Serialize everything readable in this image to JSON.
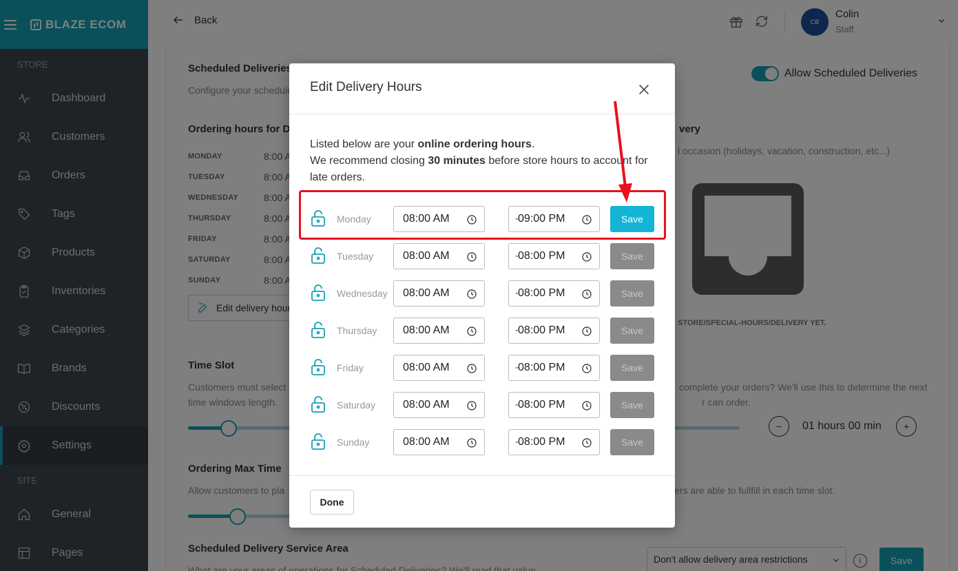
{
  "sidebar": {
    "brand": "BLAZE ECOM",
    "sections": [
      {
        "label": "STORE",
        "items": [
          "Dashboard",
          "Customers",
          "Orders",
          "Tags",
          "Products",
          "Inventories",
          "Categories",
          "Brands",
          "Discounts",
          "Settings"
        ]
      },
      {
        "label": "SITE",
        "items": [
          "General",
          "Pages"
        ]
      }
    ],
    "active_item": "Settings"
  },
  "topbar": {
    "back_label": "Back",
    "avatar_initials": "CB",
    "user_name": "Colin",
    "user_role": "Staff"
  },
  "background": {
    "scheduled_title": "Scheduled Deliveries",
    "scheduled_desc": "Configure your schedule",
    "toggle_label": "Allow Scheduled Deliveries",
    "ordering_hours_title": "Ordering hours for D",
    "days": [
      {
        "day": "MONDAY",
        "time": "8:00 A"
      },
      {
        "day": "TUESDAY",
        "time": "8:00 A"
      },
      {
        "day": "WEDNESDAY",
        "time": "8:00 A"
      },
      {
        "day": "THURSDAY",
        "time": "8:00 A"
      },
      {
        "day": "FRIDAY",
        "time": "8:00 A"
      },
      {
        "day": "SATURDAY",
        "time": "8:00 A"
      },
      {
        "day": "SUNDAY",
        "time": "8:00 A"
      }
    ],
    "edit_button": "Edit delivery hour",
    "special_title": "very",
    "special_desc": "l occasion (holidays, vacation, construction, etc...)",
    "empty_text": "STORE/SPECIAL-HOURS/DELIVERY YET.",
    "time_slot_title": "Time Slot",
    "time_slot_desc1": "Customers must select",
    "time_slot_desc2": "time windows length.",
    "time_slot_right1": "complete your orders? We'll use this to determine the next",
    "time_slot_right2": "r can order.",
    "duration": "01 hours 00 min",
    "max_time_title": "Ordering Max Time",
    "max_time_desc": "Allow customers to pla",
    "max_time_right": "ers are able to fullfill in each time slot.",
    "service_area_title": "Scheduled Delivery Service Area",
    "service_area_desc": "What are your areas of operations for Scheduled Deliveries? We'll read that value",
    "area_select": "Don't allow delivery area restrictions",
    "save_label": "Save"
  },
  "modal": {
    "title": "Edit Delivery Hours",
    "intro_prefix": "Listed below are your ",
    "intro_bold1": "online ordering hours",
    "intro_mid": ".",
    "intro_rec": "We recommend closing ",
    "intro_bold2": "30 minutes",
    "intro_suffix": " before store hours to account for late orders.",
    "rows": [
      {
        "day": "Monday",
        "open": "08:00 AM",
        "close": "09:00 PM",
        "save": "Save",
        "enabled": true
      },
      {
        "day": "Tuesday",
        "open": "08:00 AM",
        "close": "08:00 PM",
        "save": "Save",
        "enabled": false
      },
      {
        "day": "Wednesday",
        "open": "08:00 AM",
        "close": "08:00 PM",
        "save": "Save",
        "enabled": false
      },
      {
        "day": "Thursday",
        "open": "08:00 AM",
        "close": "08:00 PM",
        "save": "Save",
        "enabled": false
      },
      {
        "day": "Friday",
        "open": "08:00 AM",
        "close": "08:00 PM",
        "save": "Save",
        "enabled": false
      },
      {
        "day": "Saturday",
        "open": "08:00 AM",
        "close": "08:00 PM",
        "save": "Save",
        "enabled": false
      },
      {
        "day": "Sunday",
        "open": "08:00 AM",
        "close": "08:00 PM",
        "save": "Save",
        "enabled": false
      }
    ],
    "separator": "-",
    "done_label": "Done"
  },
  "colors": {
    "accent": "#14a0b4",
    "save_enabled": "#14b4d6",
    "save_disabled": "#8a8a8a",
    "annotation": "#e8101f",
    "sidebar_bg": "#3d4650"
  },
  "icons": [
    "hamburger-icon",
    "logo-icon",
    "activity-icon",
    "users-icon",
    "inbox-icon",
    "tag-icon",
    "box-icon",
    "clipboard-icon",
    "layers-icon",
    "book-icon",
    "percent-icon",
    "gear-icon",
    "home-icon",
    "layout-icon",
    "arrow-left-icon",
    "gift-icon",
    "refresh-icon",
    "chevron-down-icon",
    "close-icon",
    "lock-icon",
    "clock-icon",
    "edit-icon",
    "info-icon"
  ]
}
